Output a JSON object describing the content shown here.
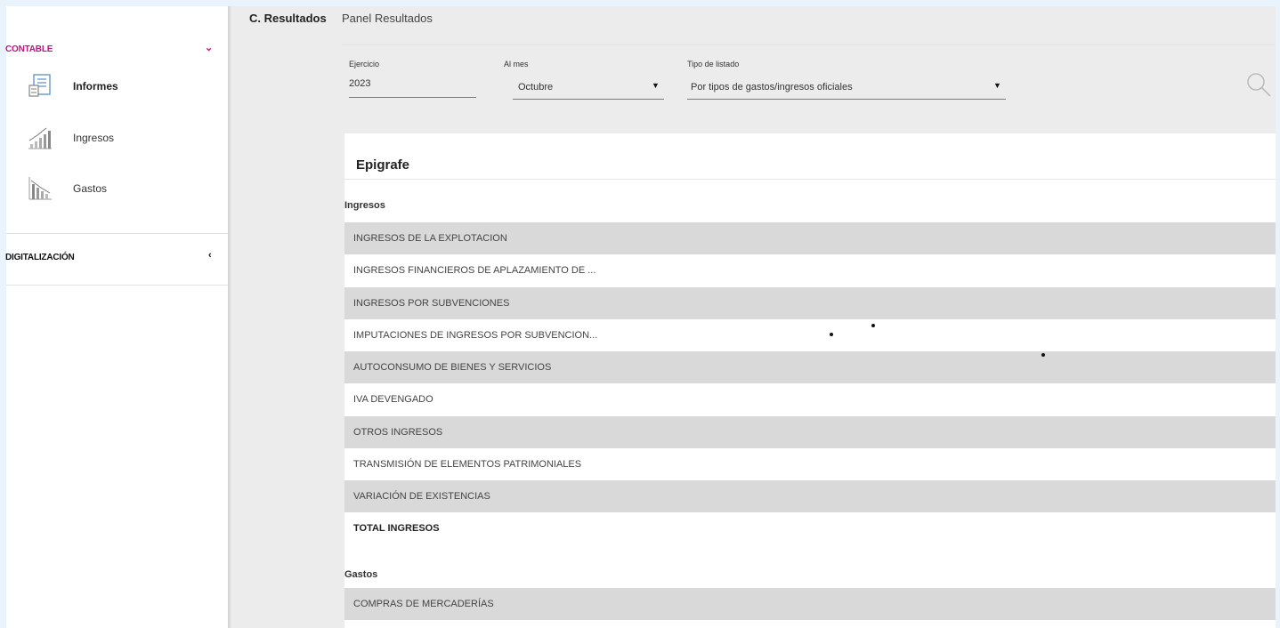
{
  "sidebar": {
    "contable_label": "CONTABLE",
    "items": [
      {
        "label": "Informes",
        "icon": "report-icon",
        "active": true
      },
      {
        "label": "Ingresos",
        "icon": "income-chart-icon",
        "active": false
      },
      {
        "label": "Gastos",
        "icon": "expense-chart-icon",
        "active": false
      }
    ],
    "digital_label": "DIGITALIZACIÓN",
    "accent_color": "#c0147e"
  },
  "header": {
    "title": "C. Resultados",
    "subtitle": "Panel Resultados"
  },
  "filters": {
    "ejercicio_label": "Ejercicio",
    "ejercicio_value": "2023",
    "mes_label": "Al mes",
    "mes_value": "Octubre",
    "tipo_label": "Tipo de listado",
    "tipo_value": "Por tipos de gastos/ingresos oficiales"
  },
  "table": {
    "column_header": "Epigrafe",
    "ingresos_label": "Ingresos",
    "ingresos_rows": [
      "INGRESOS DE LA EXPLOTACION",
      "INGRESOS FINANCIEROS DE APLAZAMIENTO DE ...",
      "INGRESOS POR SUBVENCIONES",
      "IMPUTACIONES DE INGRESOS POR SUBVENCION...",
      "AUTOCONSUMO DE BIENES Y SERVICIOS",
      "IVA DEVENGADO",
      "OTROS INGRESOS",
      "TRANSMISIÓN DE ELEMENTOS PATRIMONIALES",
      "VARIACIÓN DE EXISTENCIAS"
    ],
    "total_ingresos": "TOTAL INGRESOS",
    "gastos_label": "Gastos",
    "gastos_rows": [
      "COMPRAS DE MERCADERÍAS"
    ]
  }
}
